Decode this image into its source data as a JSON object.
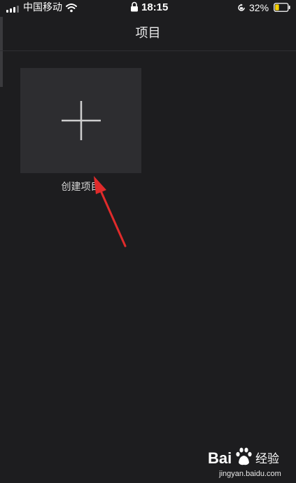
{
  "status_bar": {
    "carrier": "中国移动",
    "time": "18:15",
    "battery_percent": "32%",
    "battery_level": 0.32,
    "icons": [
      "signal-icon",
      "wifi-icon",
      "lock-icon",
      "rotation-lock-icon",
      "battery-icon"
    ]
  },
  "nav": {
    "title": "项目"
  },
  "projects": {
    "create_label": "创建项目",
    "create_icon": "plus-icon"
  },
  "annotation": {
    "arrow_color": "#e02b2b"
  },
  "watermark": {
    "logo_text": "Bai 经验",
    "url": "jingyan.baidu.com"
  },
  "colors": {
    "background": "#1d1d1f",
    "tile": "#2d2d30",
    "battery_fill": "#f5d000"
  }
}
